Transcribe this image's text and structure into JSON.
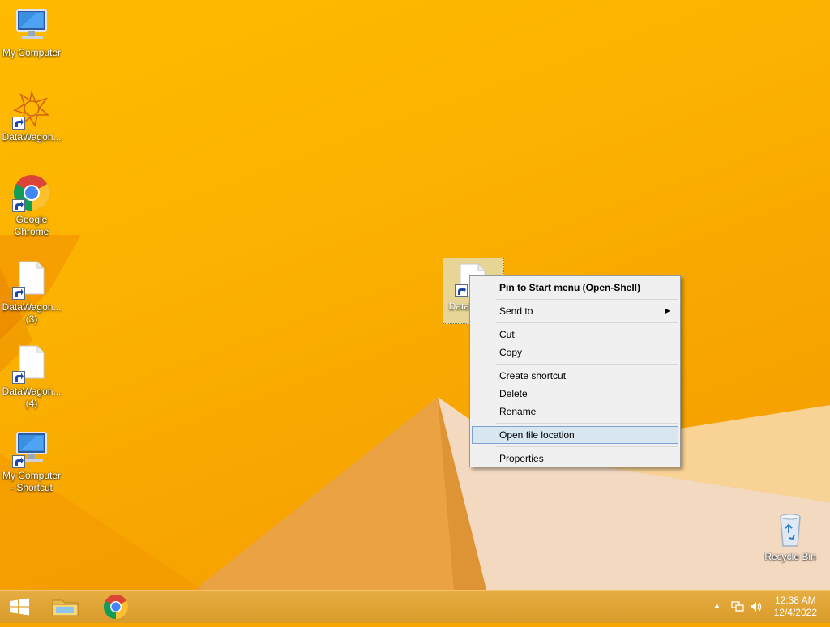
{
  "desktop": {
    "icons": [
      {
        "label": "My Computer",
        "icon": "computer-icon"
      },
      {
        "label": "DataWagon...",
        "icon": "datawagon-logo-icon"
      },
      {
        "label": "Google Chrome",
        "icon": "chrome-icon"
      },
      {
        "label": "DataWagon... (3)",
        "icon": "document-icon"
      },
      {
        "label": "DataWagon... (4)",
        "icon": "document-icon"
      },
      {
        "label": "My Computer - Shortcut",
        "icon": "computer-icon"
      },
      {
        "label": "Recycle Bin",
        "icon": "recycle-bin-icon"
      }
    ],
    "selected_item": {
      "label": "DataW... on",
      "icon": "document-icon"
    }
  },
  "context_menu": {
    "items": [
      {
        "label": "Pin to Start menu (Open-Shell)",
        "bold": true
      },
      {
        "label": "Send to",
        "submenu": true
      },
      {
        "label": "Cut"
      },
      {
        "label": "Copy"
      },
      {
        "label": "Create shortcut"
      },
      {
        "label": "Delete"
      },
      {
        "label": "Rename"
      },
      {
        "label": "Open file location",
        "highlighted": true
      },
      {
        "label": "Properties"
      }
    ]
  },
  "taskbar": {
    "start_icon": "windows-logo-icon",
    "pinned": [
      {
        "name": "File Explorer",
        "icon": "folder-icon"
      },
      {
        "name": "Google Chrome",
        "icon": "chrome-icon"
      }
    ],
    "tray": {
      "time": "12:38 AM",
      "date": "12/4/2022",
      "icons": [
        "show-hidden-icons-chevron",
        "network-icon",
        "volume-icon"
      ]
    }
  },
  "colors": {
    "wallpaper": "#f7a800",
    "taskbar": "#dfa53a",
    "menu_background": "#f0f0f0",
    "menu_highlight": "#d8e6f2"
  }
}
